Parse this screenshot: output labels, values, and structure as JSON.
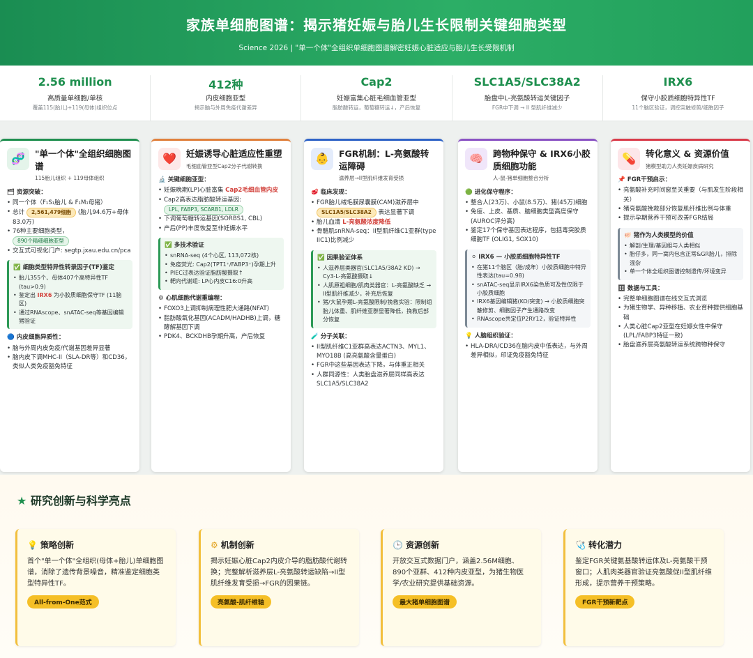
{
  "header": {
    "title": "家族单细胞图谱：揭示猪妊娠与胎儿生长限制关键细胞类型",
    "subtitle": "Science 2026 | \"单一个体\"全组织单细胞图谱解密妊娠心脏适应与胎儿生长受限机制"
  },
  "stats": [
    {
      "value": "2.56 million",
      "label": "高质量单细胞/单核",
      "desc": "覆盖115(胎儿)+119(母体)组织位点"
    },
    {
      "value": "412种",
      "label": "内皮细胞亚型",
      "desc": "揭示脑与外周免疫代谢差异"
    },
    {
      "value": "Cap2",
      "label": "妊娠富集心脏毛细血管亚型",
      "desc": "脂肪酸转运，葡萄糖转运↓，产后恢复"
    },
    {
      "value": "SLC1A5/SLC38A2",
      "label": "胎盘中L-亮氨酸转运关键因子",
      "desc": "FGR中下调 → II 型肌纤维减少"
    },
    {
      "value": "IRX6",
      "label": "保守小胶质细胞特异性TF",
      "desc": "11个脑区验证，调控突触修剪/细胞因子"
    }
  ],
  "card1": {
    "icon": "🧬",
    "title": "\"单一个体\"全组织细胞图谱",
    "sub": "115胎儿组织 + 119母体组织",
    "s1": "🗂 资源突破：",
    "i1": "同一个体（F₁S₁胎儿 & F₁M₁母猪）",
    "i2a": "总计",
    "i2pill": "2,561,479细胞",
    "i2b": "(胎儿94.6万+母体83.0万)",
    "i3": "76种主要细胞类型，",
    "i3pill": "890个精细细胞亚型",
    "i4": "交互式可视化门户: segtp.jxau.edu.cn/pca",
    "boxh": "✅ 细胞类型特异性转录因子(TF)鉴定",
    "b1": "胎儿355个、母体407个高特异性TF (tau>0.9)",
    "b2a": "鉴定出",
    "b2h": "IRX6",
    "b2b": "为小胶质细胞保守TF (11脑区)",
    "b3": "通过RNAscope、snATAC-seq等基因编辑猪验证",
    "s2": "🔵 内皮细胞异质性：",
    "i5": "脑与外周内皮免疫/代谢基因差异显著",
    "i6": "脑内皮下调MHC-II（SLA-DR等）和CD36，类似人类免疫豁免特征"
  },
  "card2": {
    "icon": "❤️",
    "title": "妊娠诱导心脏适应性重塑",
    "sub": "毛细血管亚型Cap2分子代谢转换",
    "s1": "🔬 关键细胞亚型：",
    "i1a": "妊娠晚期(LP)心脏富集",
    "i1h": "Cap2毛细血管内皮",
    "i2": "Cap2高表达脂肪酸转运基因:",
    "i2pill": "LPL, FABP3, SCARB1, LDLR",
    "i3": "下调葡萄糖转运基因(SORBS1, CBL)",
    "i4": "产后(PP)丰度恢复至非妊娠水平",
    "boxh": "✅ 多技术验证",
    "b1": "snRNA-seq (4个心区, 113,072核)",
    "b2": "免疫荧光: Cap2(TPT1⁺/FABP3⁺)孕期上升",
    "b3": "PIEC过表达验证脂肪酸摄取↑",
    "b4": "靶向代谢组: LP心内皮C16:0升高",
    "s2": "⚙ 心肌细胞代谢重编程：",
    "i5": "FOXO3上调抑制病理性肥大通路(NFAT)",
    "i6": "脂肪酸氧化基因(ACADM/HADHB)上调，糖酵解基因下调",
    "i7": "PDK4、BCKDHB孕期升高，产后恢复"
  },
  "card3": {
    "icon": "👶",
    "title": "FGR机制：L-亮氨酸转运障碍",
    "sub": "滋养层→II型肌纤维发育受损",
    "s1": "🥩 临床发现：",
    "i1": "FGR胎儿绒毛膜尿囊膜(CAM)滋养层中",
    "i1pill": "SLC1A5/SLC38A2",
    "i1b": "表达显著下调",
    "i2a": "胎儿血清",
    "i2h": "L-亮氨酸浓度降低",
    "i3": "骨骼肌snRNA-seq：II型肌纤维C1亚群(type IIC1)比例减少",
    "boxh": "✅ 因果验证体系",
    "b1": "人滋养层类器官(SLC1A5/38A2 KD) → Cy3-L-亮氨酸摄取↓",
    "b2": "人肌原祖细胞/肌肉类器官：L-亮氨酸缺乏 → II型肌纤维减少，补充后恢复",
    "b3": "猪/大鼠孕期L-亮氨酸限制/挽救实验：限制组胎儿体重、肌纤维亚群显著降低，挽救后部分恢复",
    "s2": "🧪 分子关联：",
    "i4": "II型肌纤维C1亚群高表达ACTN3、MYL1、MYO18B (高亮氨酸含量蛋白)",
    "i5": "FGR中这些基因表达下降，与体重正相关",
    "i6": "人群同源性：人类胎盘滋养层同样高表达SLC1A5/SLC38A2"
  },
  "card4": {
    "icon": "🧠",
    "title": "跨物种保守 & IRX6小胶质细胞功能",
    "sub": "人-鼠-猪单细胞整合分析",
    "s1": "🟢 进化保守程序：",
    "i1": "整合人(23万)、小鼠(8.5万)、猪(45万)细胞",
    "i2": "免疫、上皮、基质、脑细胞类型高度保守(AUROC评分高)",
    "i3": "鉴定17个保守基因表达程序，包括毒突胶质细胞TF (OLIG1, SOX10)",
    "boxh": "⚪ IRX6 — 小胶质细胞特异性TF",
    "b1": "在猪11个脑区（胎/成年）小胶质细胞中特异性表达(tau=0.98)",
    "b2": "snATAC-seq显示IRX6染色质可及性仅限于小胶质细胞",
    "b3": "IRX6基因编辑猪(KO/突变) → 小胶质细胞突触修剪、细胞因子产生通路改变",
    "b4": "RNAscope共定位P2RY12，验证特异性",
    "s2": "💡 人脑组织验证：",
    "i4": "HLA-DRA/CD36在脑内皮中低表达，与外周差异相似，印证免疫豁免特征"
  },
  "card5": {
    "icon": "💊",
    "title": "转化意义 & 资源价值",
    "sub": "猪模型助力人类妊娠疾病研究",
    "s1": "📌 FGR干预启示：",
    "i1": "亮氨酸补充时间窗至关重要（与肌发生阶段相关）",
    "i2": "猪亮氨酸挽救部分恢复肌纤维比例与体重",
    "i3": "提示孕期营养干预可改善FGR结局",
    "boxh": "🐖 猪作为人类模型的价值",
    "b1": "解剖/生理/基因组与人类相似",
    "b2": "胎仔多，同一窝内包含正常&GR胎儿，排除混杂",
    "b3": "单一个体全组织图谱控制遗传/环境变异",
    "s2": "🗄 数据与工具：",
    "i4": "完整单细胞图谱在线交互式浏览",
    "i5": "为猪生物学、异种移植、农业育种提供细胞基础",
    "i6": "人类心脏Cap2亚型在妊娠女性中保守(LPL/FABP3特征一致)",
    "i7": "胎盘滋养层亮氨酸转运系统跨物种保守"
  },
  "bottom": {
    "title": "研究创新与科学亮点",
    "cards": [
      {
        "icon": "💡",
        "title": "策略创新",
        "text": "首个\"单一个体\"全组织(母体+胎儿)单细胞图谱，消除了遗传背景噪音，精准鉴定细胞类型特异性TF。",
        "tag": "All-from-One范式"
      },
      {
        "icon": "⚙",
        "title": "机制创新",
        "text": "揭示妊娠心脏Cap2内皮介导的脂肪酸代谢转换；完整解析滋养层L-亮氨酸转运缺陷→II型肌纤维发育受损→FGR的因果链。",
        "tag": "亮氨酸-肌纤维轴"
      },
      {
        "icon": "🕒",
        "title": "资源创新",
        "text": "开放交互式数据门户，涵盖2.56M细胞、890个亚群、412种内皮亚型，为猪生物医学/农业研究提供基础资源。",
        "tag": "最大猪单细胞图谱"
      },
      {
        "icon": "🩺",
        "title": "转化潜力",
        "text": "鉴定FGR关键氨基酸转运体及L-亮氨酸干预窗口；人肌肉类器官验证亮氨酸促II型肌纤维形成，提示营养干预策略。",
        "tag": "FGR干预新靶点"
      }
    ]
  }
}
